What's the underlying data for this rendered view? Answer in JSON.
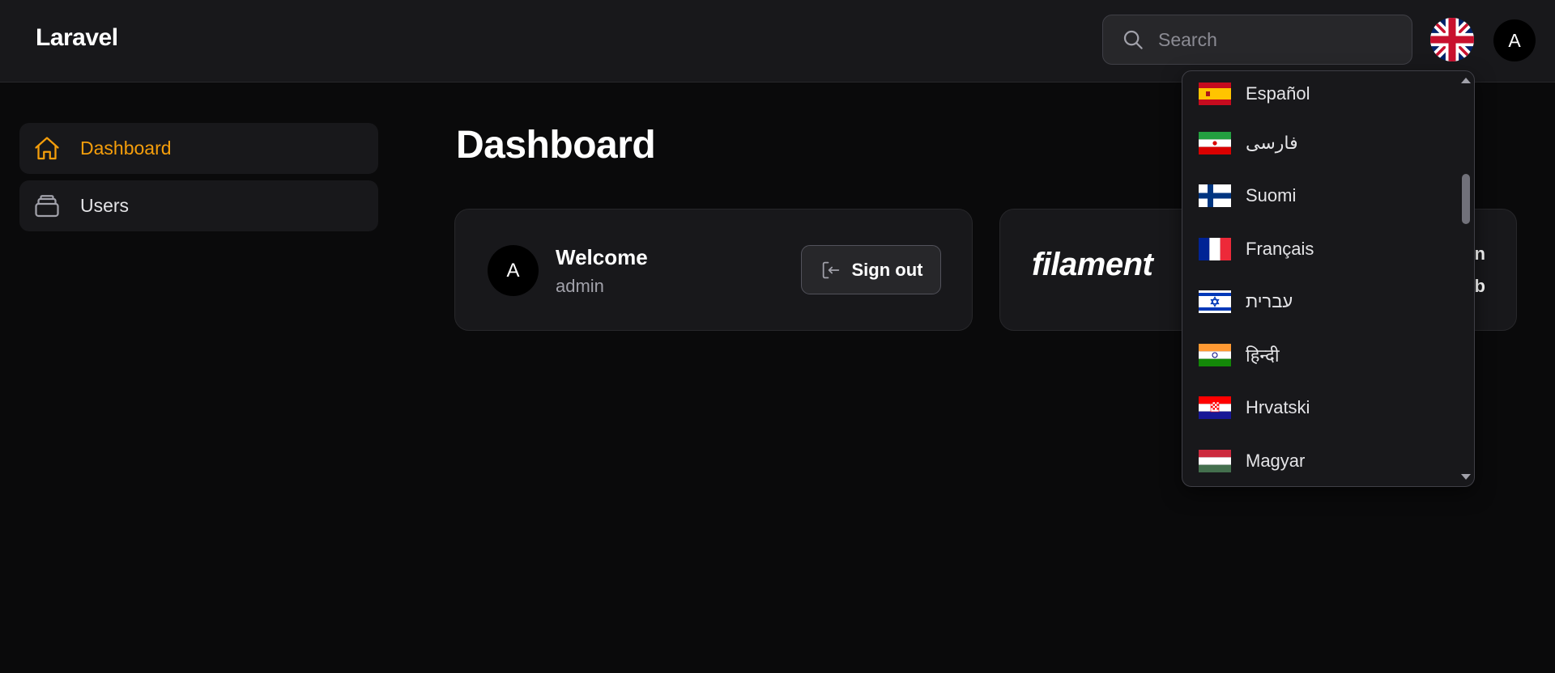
{
  "header": {
    "brand": "Laravel",
    "search": {
      "placeholder": "Search",
      "value": ""
    },
    "language_flag_icon": "uk-flag-icon",
    "user_avatar": "A"
  },
  "sidebar": {
    "items": [
      {
        "label": "Dashboard",
        "icon": "home-icon",
        "active": true
      },
      {
        "label": "Users",
        "icon": "inbox-stack-icon",
        "active": false
      }
    ]
  },
  "main": {
    "title": "Dashboard",
    "welcome_card": {
      "avatar": "A",
      "title": "Welcome",
      "username": "admin",
      "signout_label": "Sign out",
      "signout_icon": "logout-icon"
    },
    "filament_card": {
      "logo": "filament",
      "partial_line1": "n",
      "partial_line2": "b"
    }
  },
  "language_dropdown": {
    "options": [
      {
        "label": "Español",
        "flag": "spain-flag-icon"
      },
      {
        "label": "فارسی",
        "flag": "iran-flag-icon"
      },
      {
        "label": "Suomi",
        "flag": "finland-flag-icon"
      },
      {
        "label": "Français",
        "flag": "france-flag-icon"
      },
      {
        "label": "עברית",
        "flag": "israel-flag-icon"
      },
      {
        "label": "हिन्दी",
        "flag": "india-flag-icon"
      },
      {
        "label": "Hrvatski",
        "flag": "croatia-flag-icon"
      },
      {
        "label": "Magyar",
        "flag": "hungary-flag-icon"
      }
    ]
  },
  "colors": {
    "accent": "#f59e0b",
    "background": "#0a0a0b",
    "surface": "#18181b",
    "border": "#27272a"
  }
}
